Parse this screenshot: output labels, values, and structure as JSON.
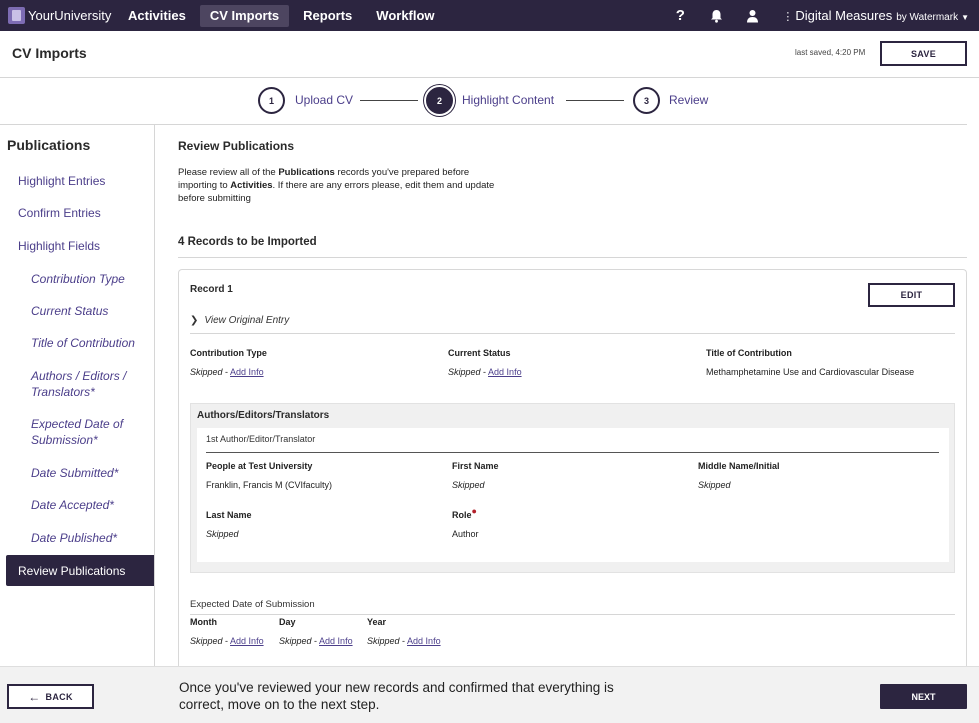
{
  "nav": {
    "logo_text": "YourUniversity",
    "items": [
      "Activities",
      "CV Imports",
      "Reports",
      "Workflow"
    ],
    "help": "?",
    "brand": "Digital Measures",
    "brand_by": "by Watermark"
  },
  "header": {
    "title": "CV Imports",
    "last_saved": "last saved, 4:20 PM",
    "save_label": "SAVE"
  },
  "stepper": [
    {
      "number": "1",
      "label": "Upload CV"
    },
    {
      "number": "2",
      "label": "Highlight Content"
    },
    {
      "number": "3",
      "label": "Review"
    }
  ],
  "sidebar": {
    "title": "Publications",
    "items": [
      "Highlight Entries",
      "Confirm Entries",
      "Highlight Fields"
    ],
    "subitems": [
      "Contribution Type",
      "Current Status",
      "Title of Contribution",
      "Authors / Editors / Translators*",
      "Expected Date of Submission*",
      "Date Submitted*",
      "Date Accepted*",
      "Date Published*"
    ],
    "active": "Review Publications"
  },
  "main": {
    "title": "Review Publications",
    "desc_1": "Please review all of the ",
    "desc_b1": "Publications",
    "desc_2": " records you've prepared before importing to ",
    "desc_b2": "Activities",
    "desc_3": ". If there are any errors please, edit them and update before submitting",
    "records_count": "4 Records to be Imported"
  },
  "record": {
    "title": "Record 1",
    "edit_label": "EDIT",
    "view_original": "View Original Entry",
    "fields": {
      "contribution_type": {
        "label": "Contribution Type",
        "value": "Skipped",
        "link": "Add Info"
      },
      "current_status": {
        "label": "Current Status",
        "value": "Skipped",
        "link": "Add Info"
      },
      "title": {
        "label": "Title of Contribution",
        "value": "Methamphetamine Use and Cardiovascular Disease"
      }
    },
    "authors": {
      "title": "Authors/Editors/Translators",
      "subtitle": "1st Author/Editor/Translator",
      "people_label": "People at Test University",
      "people_value": "Franklin, Francis M (CVIfaculty)",
      "first_label": "First Name",
      "first_value": "Skipped",
      "middle_label": "Middle Name/Initial",
      "middle_value": "Skipped",
      "last_label": "Last Name",
      "last_value": "Skipped",
      "role_label": "Role",
      "role_value": "Author"
    },
    "expected_date": {
      "title": "Expected Date of Submission",
      "month_label": "Month",
      "day_label": "Day",
      "year_label": "Year",
      "skipped": "Skipped",
      "add_info": "Add Info"
    }
  },
  "footer": {
    "back_label": "BACK",
    "message": "Once you've reviewed your new records and confirmed that everything is correct, move on to the next step.",
    "next_label": "NEXT"
  },
  "colors": {
    "primary": "#2c2540",
    "link": "#4b3e8a",
    "required": "#b3202a"
  }
}
